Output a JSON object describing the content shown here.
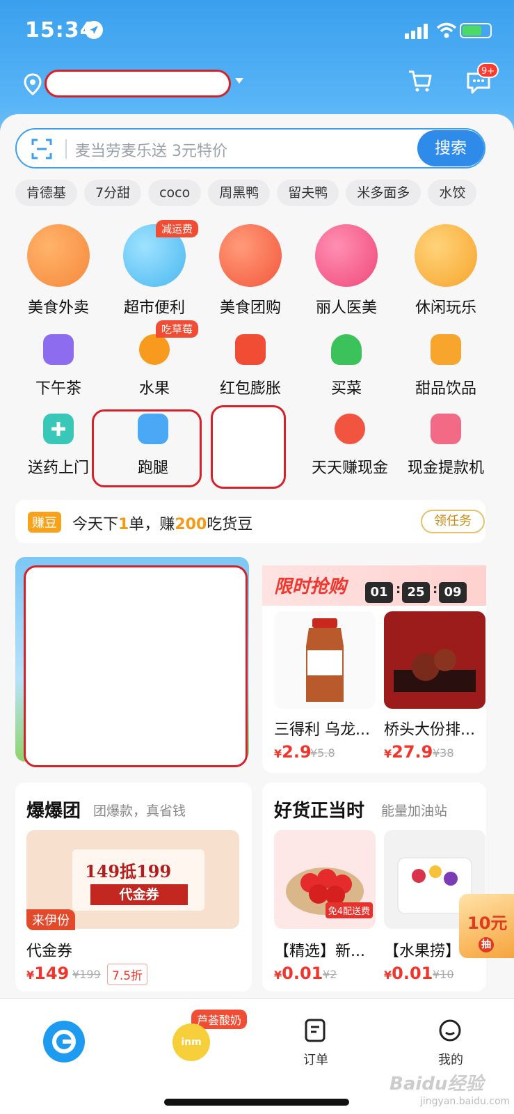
{
  "status_bar": {
    "time": "15:34"
  },
  "header": {
    "message_badge": "9+"
  },
  "search": {
    "placeholder": "麦当劳麦乐送 3元特价",
    "button": "搜索"
  },
  "hot_words": [
    "肯德基",
    "7分甜",
    "coco",
    "周黑鸭",
    "留夫鸭",
    "米多面多",
    "水饺"
  ],
  "main_categories": [
    {
      "label": "美食外卖",
      "color": "#f6893a"
    },
    {
      "label": "超市便利",
      "color": "#49b8f0",
      "tag": "减运费"
    },
    {
      "label": "美食团购",
      "color": "#f4563b"
    },
    {
      "label": "丽人医美",
      "color": "#f0487a"
    },
    {
      "label": "休闲玩乐",
      "color": "#f7a52c"
    }
  ],
  "sub_categories_row1": [
    {
      "label": "下午茶",
      "color": "#8e6cf0"
    },
    {
      "label": "水果",
      "color": "#f79a1e",
      "tag": "吃草莓"
    },
    {
      "label": "红包膨胀",
      "color": "#f04d34"
    },
    {
      "label": "买菜",
      "color": "#3cc25a"
    },
    {
      "label": "甜品饮品",
      "color": "#f7a52c"
    }
  ],
  "sub_categories_row2": [
    {
      "label": "送药上门",
      "color": "#39c7b8"
    },
    {
      "label": "跑腿",
      "color": "#4aa8f5"
    },
    {
      "label": "",
      "color": ""
    },
    {
      "label": "天天赚现金",
      "color": "#f2553f"
    },
    {
      "label": "现金提款机",
      "color": "#f26a86"
    }
  ],
  "task": {
    "badge": "赚豆",
    "text_pre": "今天下",
    "num1": "1",
    "text_mid": "单，赚",
    "num2": "200",
    "text_post": "吃货豆",
    "button": "领任务"
  },
  "flash_sale": {
    "title": "限时抢购",
    "timer": [
      "01",
      "25",
      "09"
    ],
    "products": [
      {
        "name": "三得利 乌龙...",
        "price_symbol": "¥",
        "price": "2.9",
        "original": "¥5.8"
      },
      {
        "name": "桥头大份排...",
        "price_symbol": "¥",
        "price": "27.9",
        "original": "¥38"
      }
    ]
  },
  "baobao": {
    "title": "爆爆团",
    "subtitle": "团爆款，真省钱",
    "coupon_amount": "149抵199",
    "coupon_word": "代金券",
    "brand_tag": "来伊份",
    "item_name": "代金券",
    "price_symbol": "¥",
    "price": "149",
    "original": "¥199",
    "discount": "7.5折"
  },
  "goods": {
    "title": "好货正当时",
    "subtitle": "能量加油站",
    "products": [
      {
        "name": "【精选】新...",
        "price_symbol": "¥",
        "price": "0.01",
        "original": "¥2"
      },
      {
        "name": "【水果捞】",
        "price_symbol": "¥",
        "price": "0.01",
        "original": "¥10"
      }
    ],
    "shipping_tag": "免4配送费"
  },
  "float_coupon": {
    "amount": "10元",
    "action": "抽"
  },
  "tabbar": {
    "mid_tag": "芦荟酸奶",
    "mid_icon_text": "inm",
    "orders": "订单",
    "mine": "我的"
  },
  "watermark": {
    "brand": "Baidu经验",
    "site": "jingyan.baidu.com"
  }
}
